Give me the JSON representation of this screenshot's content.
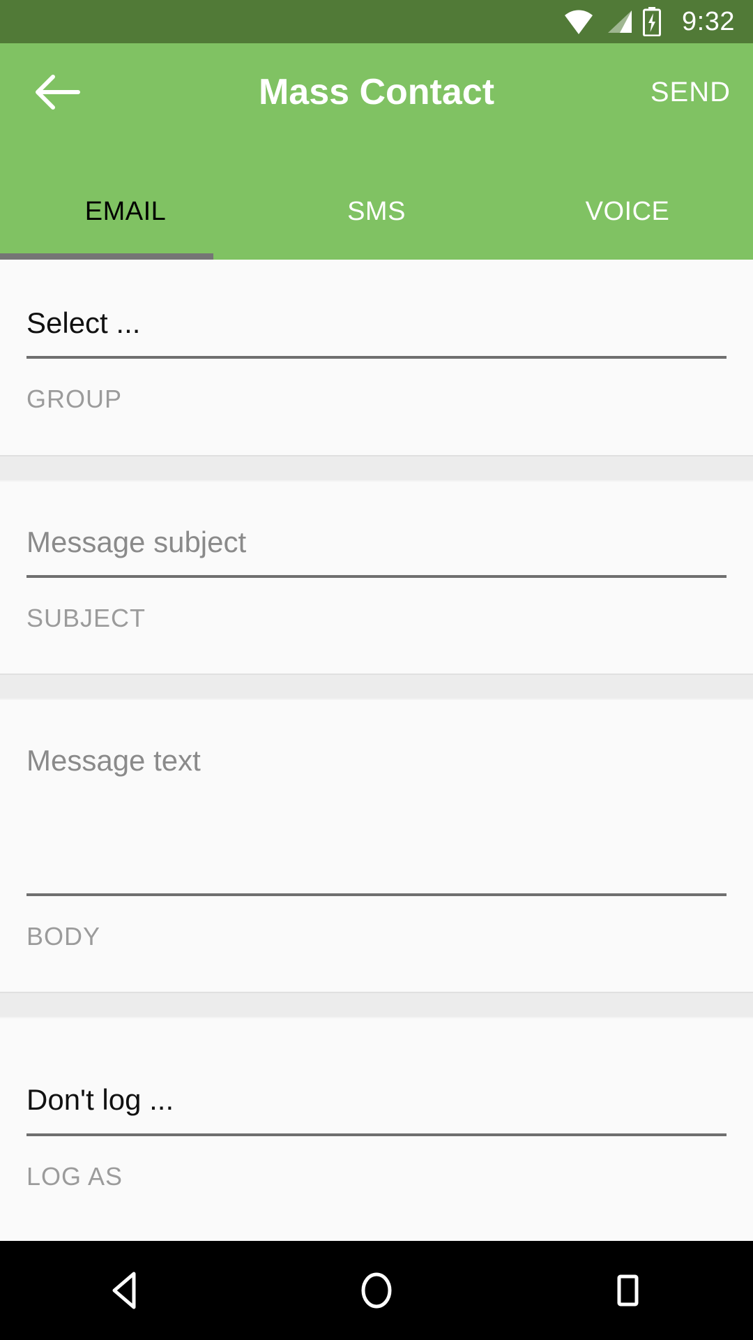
{
  "status_bar": {
    "time": "9:32",
    "icons": [
      "wifi-icon",
      "cellular-signal-icon",
      "battery-charging-icon"
    ],
    "background_color": "#517a37"
  },
  "app_bar": {
    "back_label": "back-arrow",
    "title": "Mass Contact",
    "action_label": "SEND",
    "background_color": "#80c263",
    "text_color": "#ffffff"
  },
  "tabs": {
    "items": [
      {
        "label": "EMAIL",
        "active": true
      },
      {
        "label": "SMS",
        "active": false
      },
      {
        "label": "VOICE",
        "active": false
      }
    ],
    "indicator_color": "#757575",
    "active_text_color": "#000000",
    "inactive_text_color": "#ffffff"
  },
  "form": {
    "group": {
      "value": "Select ...",
      "placeholder": "Select ...",
      "caption": "GROUP"
    },
    "subject": {
      "value": "",
      "placeholder": "Message subject",
      "caption": "SUBJECT"
    },
    "body": {
      "value": "",
      "placeholder": "Message text",
      "caption": "BODY"
    },
    "log_as": {
      "value": "Don't log ...",
      "placeholder": "Don't log ...",
      "caption": "LOG AS"
    }
  },
  "nav_bar": {
    "buttons": [
      "back-triangle-icon",
      "home-circle-icon",
      "recents-square-icon"
    ],
    "background_color": "#000000"
  }
}
